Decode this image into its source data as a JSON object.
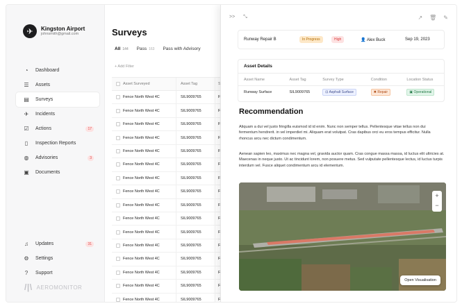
{
  "org": {
    "name": "Kingston Airport",
    "email": "johnsmith@gmail.com"
  },
  "sidebar": {
    "items": [
      {
        "label": "Dashboard",
        "icon": "gauge-icon"
      },
      {
        "label": "Assets",
        "icon": "stack-icon"
      },
      {
        "label": "Surveys",
        "icon": "clipboard-icon",
        "active": true
      },
      {
        "label": "Incidents",
        "icon": "plane-icon"
      },
      {
        "label": "Actions",
        "icon": "checkbox-icon",
        "badge": "17"
      },
      {
        "label": "Inspection Reports",
        "icon": "file-icon"
      },
      {
        "label": "Advisories",
        "icon": "globe-icon",
        "badge": "3"
      },
      {
        "label": "Documents",
        "icon": "image-icon"
      }
    ],
    "bottom": [
      {
        "label": "Updates",
        "icon": "bell-icon",
        "badge": "31"
      },
      {
        "label": "Settings",
        "icon": "gear-icon"
      },
      {
        "label": "Support",
        "icon": "help-icon"
      }
    ],
    "brand": "AEROMONITOR"
  },
  "main": {
    "title": "Surveys",
    "tabs": [
      {
        "label": "All",
        "count": "144"
      },
      {
        "label": "Pass",
        "count": "163"
      },
      {
        "label": "Pass with Advisory",
        "count": ""
      }
    ],
    "add_filter": "+ Add Filter",
    "columns": [
      "Asset Surveyed",
      "Asset Tag",
      "S"
    ],
    "rows": [
      [
        "Fence North West 4C",
        "SIL9009765",
        "F"
      ],
      [
        "Fence North West 4C",
        "SIL9009765",
        "F"
      ],
      [
        "Fence North West 4C",
        "SIL9009765",
        "F"
      ],
      [
        "Fence North West 4C",
        "SIL9009765",
        "F"
      ],
      [
        "Fence North West 4C",
        "SIL9009765",
        "F"
      ],
      [
        "Fence North West 4C",
        "SIL9009765",
        "F"
      ],
      [
        "Fence North West 4C",
        "SIL9009765",
        "F"
      ],
      [
        "Fence North West 4C",
        "SIL9009765",
        "F"
      ],
      [
        "Fence North West 4C",
        "SIL9009765",
        "F"
      ],
      [
        "Fence North West 4C",
        "SIL9009765",
        "F"
      ],
      [
        "Fence North West 4C",
        "SIL9009765",
        "F"
      ],
      [
        "Fence North West 4C",
        "SIL9009765",
        "F"
      ],
      [
        "Fence North West 4C",
        "SIL9009765",
        "F"
      ],
      [
        "Fence North West 4C",
        "SIL9009765",
        "F"
      ],
      [
        "Fence North West 4C",
        "SIL9009765",
        "F"
      ],
      [
        "Fence North West 4C",
        "SIL9009765",
        "F"
      ]
    ]
  },
  "panel": {
    "nav": [
      ">>",
      "⤡"
    ],
    "summary": {
      "name": "Runway Repair B",
      "status": "In Progress",
      "priority": "High",
      "assignee": "Alex Buck",
      "date": "Sep 19, 2023"
    },
    "asset_details": {
      "title": "Asset Details",
      "columns": [
        "Asset Name",
        "Asset Tag",
        "Survey Type",
        "Condition",
        "Location Status"
      ],
      "row": [
        "Runway Surface",
        "SIL9009765",
        "Asphalt Surface",
        "Repair",
        "Operational"
      ]
    },
    "recommendation": {
      "title": "Recommendation",
      "p1": "Aliquam a dui vel justo fringilla euismod id id enim. Nunc non semper tellus. Pellentesque vitae tellus non dui fermentum hendrerit. in vel imperdiet mi. Aliquam erat volutpat. Cras dapibus orci eu eros tempus efficitur. Nulla rhoncus arcu nec dictum condimentum.",
      "p2": "Aenean sapien leo, maximus nec magna vel, gravida auctor quam. Cras congue massa massa, id luctus elit ultricies at. Maecenas in neque justo. Ut ac tincidunt lorem, non posuere metus. Sed vulputate pellentesque lectus, id luctus turpis interdum vel. Fusce aliquet condimentum arcu id elementum."
    },
    "map": {
      "open_label": "Open Visualisation",
      "zoom_in": "+",
      "zoom_out": "−"
    }
  },
  "colors": {
    "accent_red": "#e04848",
    "runway_overlay": "#e0705a",
    "map_bg": "#5e6b48"
  }
}
